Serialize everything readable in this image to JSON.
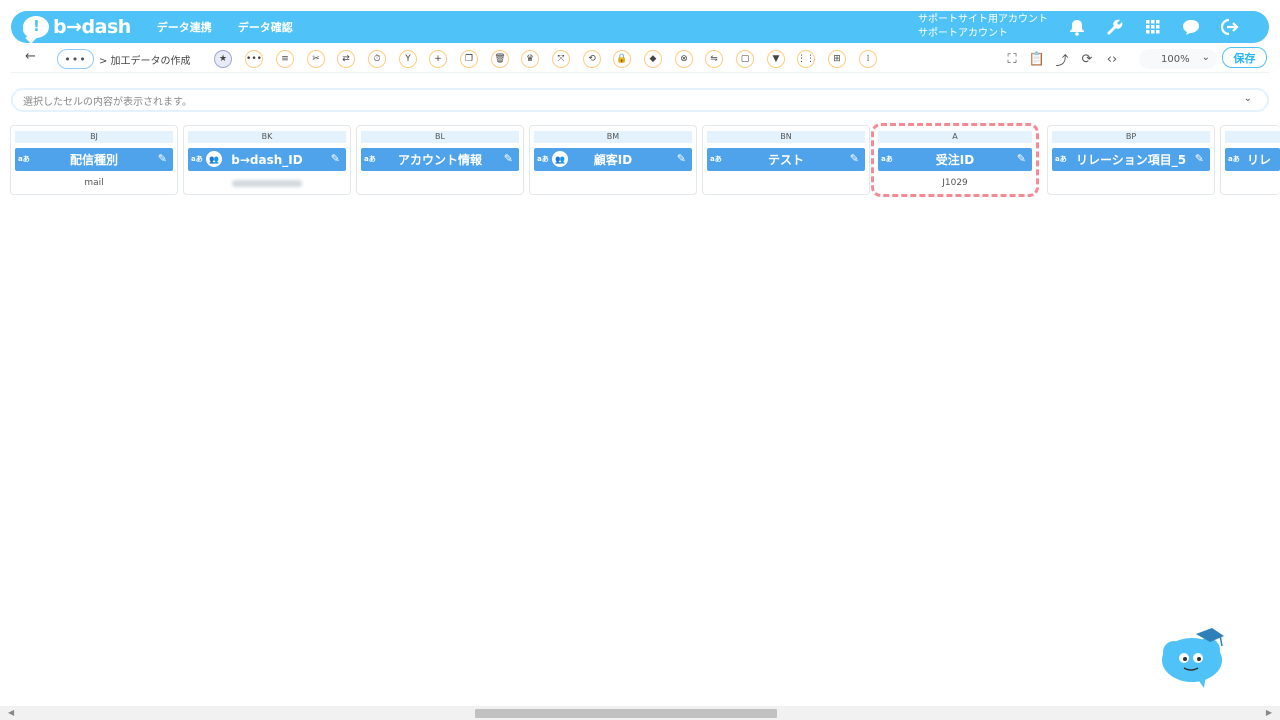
{
  "app": {
    "logo_text": "b→dash"
  },
  "nav": {
    "items": [
      "データ連携",
      "データ確認"
    ]
  },
  "account": {
    "line1": "サポートサイト用アカウント",
    "line2": "サポートアカウント"
  },
  "toolbar": {
    "more_label": "•••",
    "breadcrumb": "> 加工データの作成",
    "zoom_value": "100%",
    "save_label": "保存"
  },
  "cell_bar": {
    "placeholder": "選択したセルの内容が表示されます。"
  },
  "columns": [
    {
      "letter": "BJ",
      "name": "配信種別",
      "type": "aあ",
      "value": "mail"
    },
    {
      "letter": "BK",
      "name": "b→dash_ID",
      "type": "aあ",
      "value": ""
    },
    {
      "letter": "BL",
      "name": "アカウント情報",
      "type": "aあ",
      "value": ""
    },
    {
      "letter": "BM",
      "name": "顧客ID",
      "type": "aあ",
      "value": ""
    },
    {
      "letter": "BN",
      "name": "テスト",
      "type": "aあ",
      "value": ""
    },
    {
      "letter": "A",
      "name": "受注ID",
      "type": "aあ",
      "value": "J1029"
    },
    {
      "letter": "BP",
      "name": "リレーション項目_5",
      "type": "aあ",
      "value": ""
    },
    {
      "letter": "",
      "name": "リレ",
      "type": "aあ",
      "value": ""
    }
  ],
  "colors": {
    "brand": "#4fc3f7",
    "header": "#4fa3ea",
    "highlight": "#f48b94"
  }
}
